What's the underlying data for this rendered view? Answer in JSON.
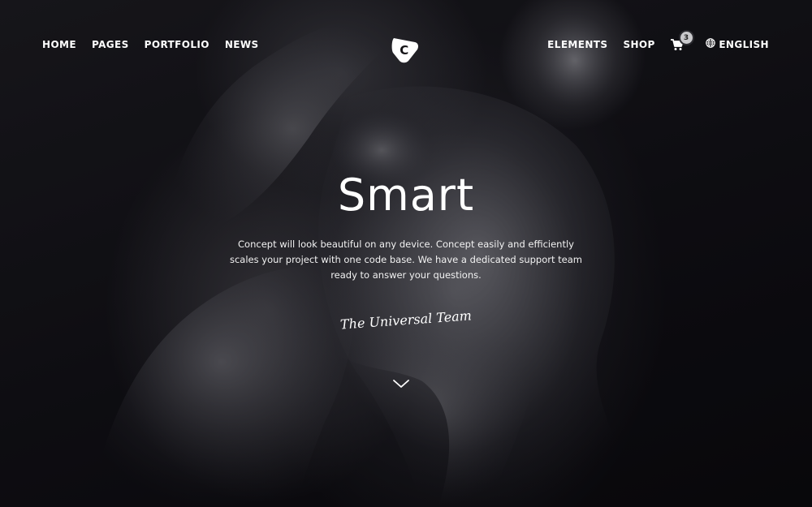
{
  "nav": {
    "left": [
      {
        "label": "HOME"
      },
      {
        "label": "PAGES"
      },
      {
        "label": "PORTFOLIO"
      },
      {
        "label": "NEWS"
      }
    ],
    "right": {
      "elements": "ELEMENTS",
      "shop": "SHOP",
      "cart_count": "3",
      "language": "ENGLISH"
    },
    "logo_letter": "C"
  },
  "hero": {
    "title": "Smart",
    "description": "Concept will look beautiful on any device. Concept easily and efficiently scales your project with one code base. We have a dedicated support team ready to answer your questions.",
    "signature": "The Universal Team"
  },
  "icons": {
    "cart": "shopping-cart-icon",
    "globe": "globe-icon",
    "scroll": "chevron-down-icon"
  },
  "colors": {
    "background": "#0d0c10",
    "text": "#ffffff",
    "badge": "#c9c9cc"
  }
}
